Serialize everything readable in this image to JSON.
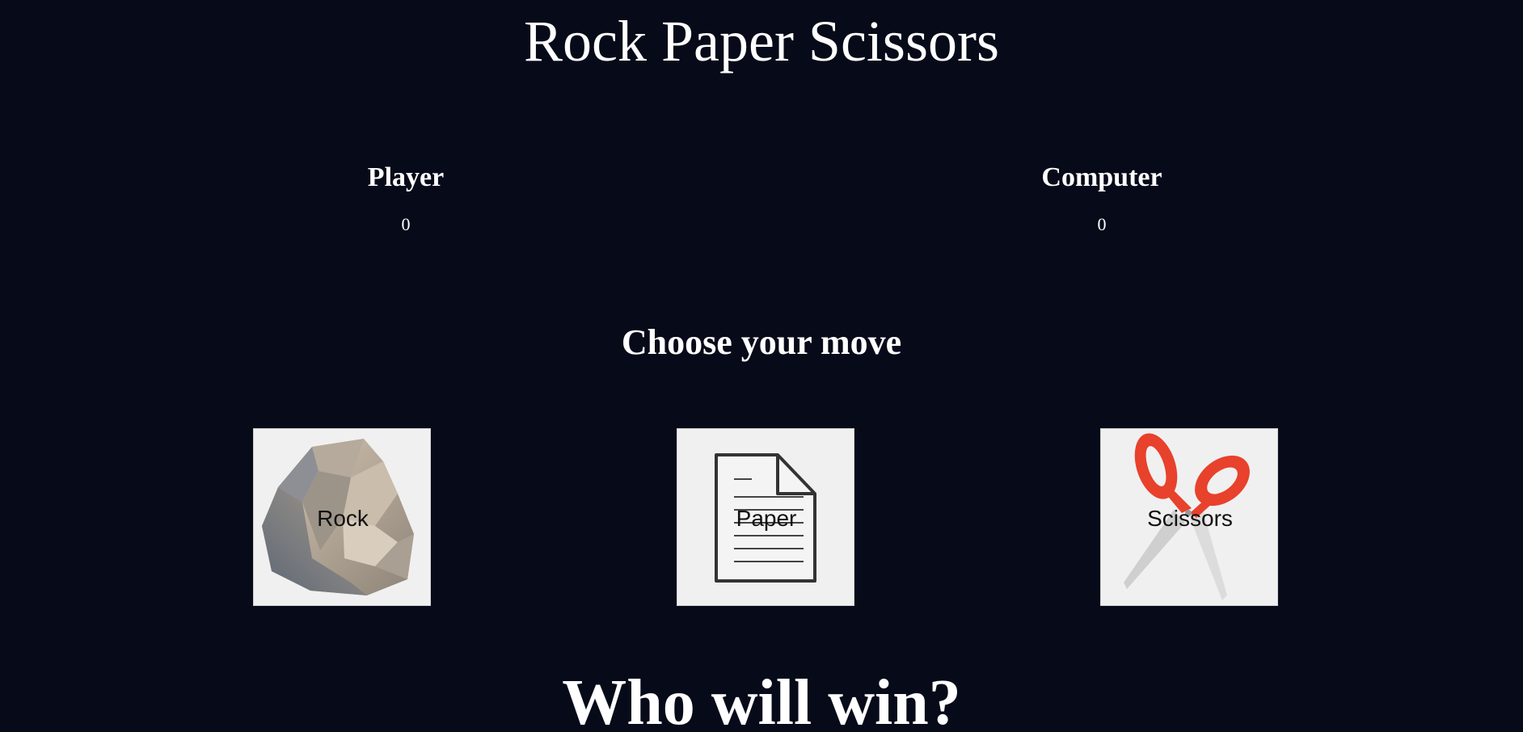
{
  "header": {
    "title": "Rock Paper Scissors"
  },
  "scoreboard": {
    "player": {
      "label": "Player",
      "score": "0"
    },
    "computer": {
      "label": "Computer",
      "score": "0"
    }
  },
  "prompt": "Choose your move",
  "moves": [
    {
      "label": "Rock",
      "icon": "rock-icon"
    },
    {
      "label": "Paper",
      "icon": "paper-icon"
    },
    {
      "label": "Scissors",
      "icon": "scissors-icon"
    }
  ],
  "result": "Who will win?",
  "colors": {
    "background": "#070a19",
    "text": "#ffffff",
    "button_bg": "#f0f0f0",
    "scissors_handle": "#e8412c"
  }
}
